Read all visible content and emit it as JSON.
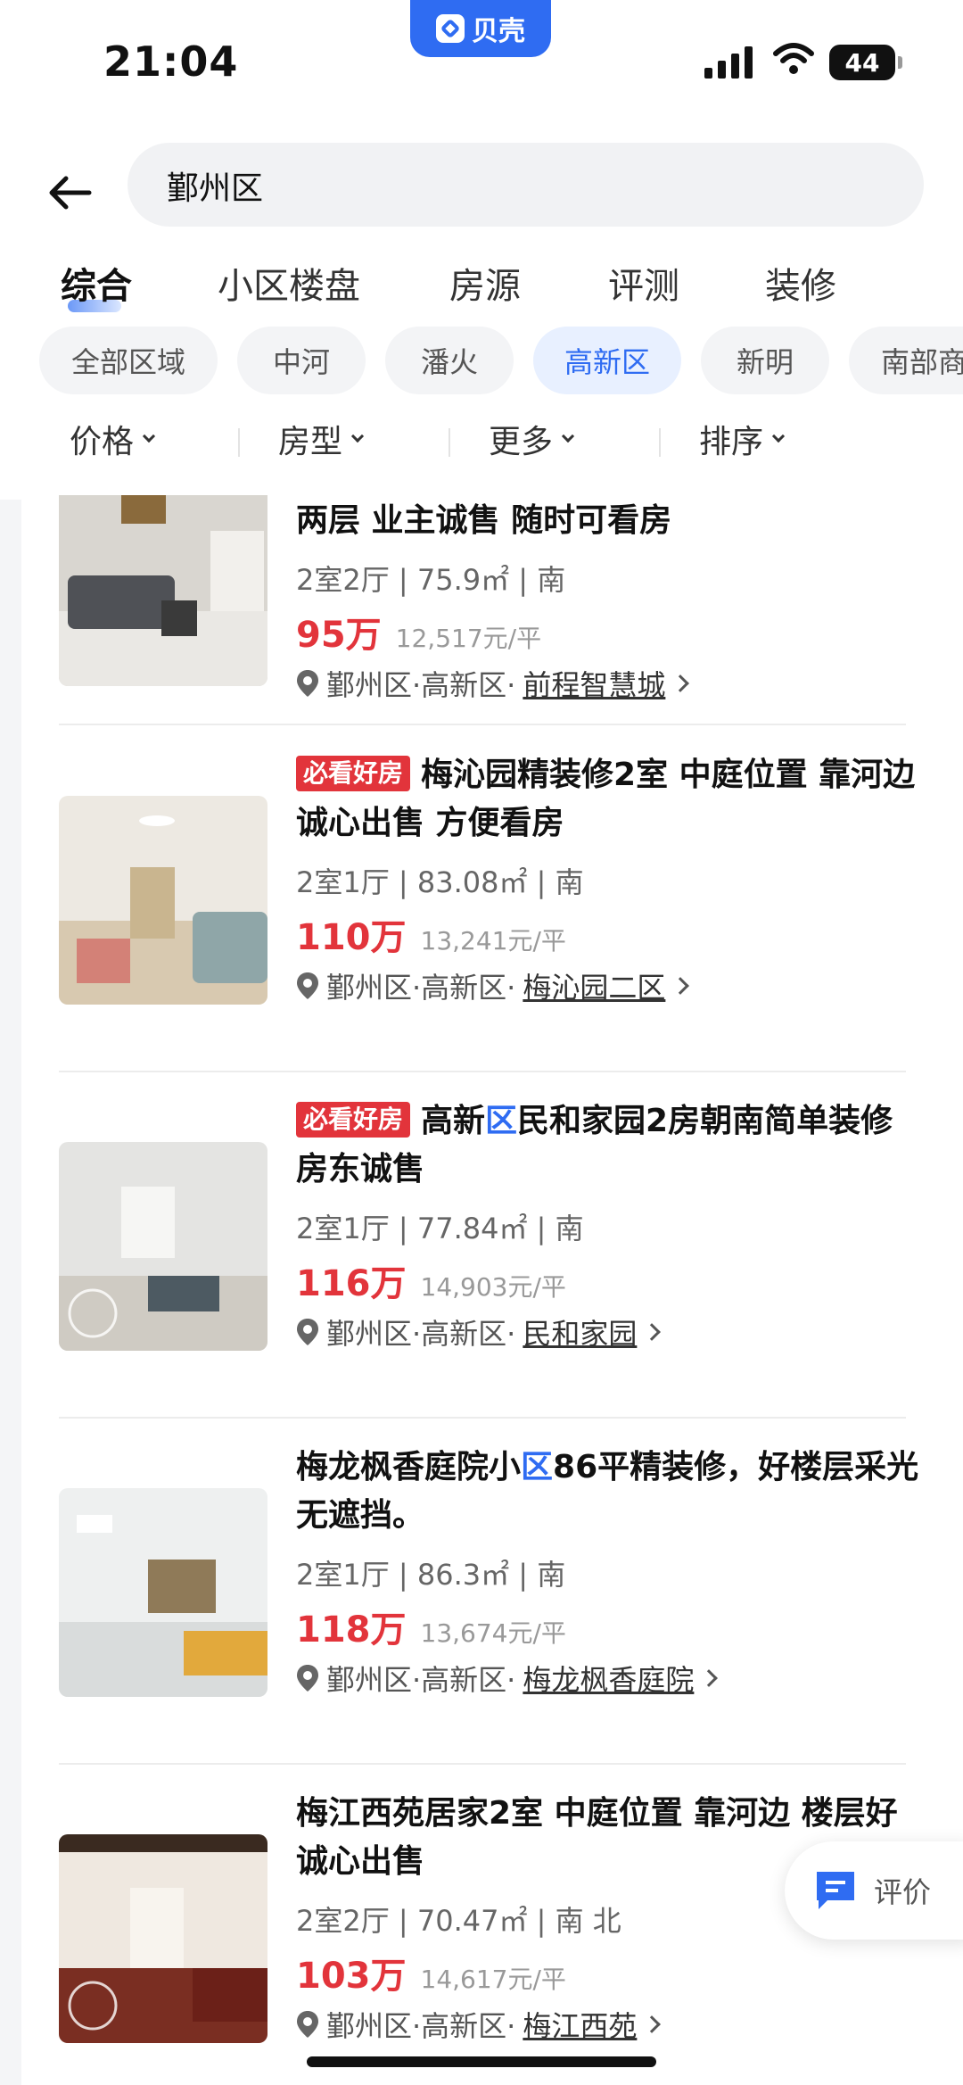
{
  "status": {
    "time": "21:04",
    "app_name": "贝壳",
    "battery": "44"
  },
  "search": {
    "query": "鄞州区"
  },
  "tabs": [
    "综合",
    "小区楼盘",
    "房源",
    "评测",
    "装修"
  ],
  "chips": [
    "全部区域",
    "中河",
    "潘火",
    "高新区",
    "新明",
    "南部商"
  ],
  "filters": [
    "价格",
    "房型",
    "更多",
    "排序"
  ],
  "listings": [
    {
      "badge": "",
      "title_pre": "两层 业主诚售 随时可看房",
      "title_hl": "",
      "title_post": "",
      "meta": "2室2厅 | 75.9㎡ | 南",
      "price": "95万",
      "unit_price": "12,517元/平",
      "loc_prefix": "鄞州区·高新区·",
      "community": "前程智慧城"
    },
    {
      "badge": "必看好房",
      "title_pre": "梅沁园精装修2室 中庭位置 靠河边 诚心出售 方便看房",
      "title_hl": "",
      "title_post": "",
      "meta": "2室1厅 | 83.08㎡ | 南",
      "price": "110万",
      "unit_price": "13,241元/平",
      "loc_prefix": "鄞州区·高新区·",
      "community": "梅沁园二区"
    },
    {
      "badge": "必看好房",
      "title_pre": "高新",
      "title_hl": "区",
      "title_post": "民和家园2房朝南简单装修房东诚售",
      "meta": "2室1厅 | 77.84㎡ | 南",
      "price": "116万",
      "unit_price": "14,903元/平",
      "loc_prefix": "鄞州区·高新区·",
      "community": "民和家园"
    },
    {
      "badge": "",
      "title_pre": "梅龙枫香庭院小",
      "title_hl": "区",
      "title_post": "86平精装修，好楼层采光无遮挡。",
      "meta": "2室1厅 | 86.3㎡ | 南",
      "price": "118万",
      "unit_price": "13,674元/平",
      "loc_prefix": "鄞州区·高新区·",
      "community": "梅龙枫香庭院"
    },
    {
      "badge": "",
      "title_pre": "梅江西苑居家2室 中庭位置 靠河边 楼层好诚心出售",
      "title_hl": "",
      "title_post": "",
      "meta": "2室2厅 | 70.47㎡ | 南 北",
      "price": "103万",
      "unit_price": "14,617元/平",
      "loc_prefix": "鄞州区·高新区·",
      "community": "梅江西苑"
    }
  ],
  "float_button": {
    "label": "评价"
  },
  "colors": {
    "accent": "#2f6cf2",
    "price": "#e2343b",
    "badge": "#e2343b"
  }
}
